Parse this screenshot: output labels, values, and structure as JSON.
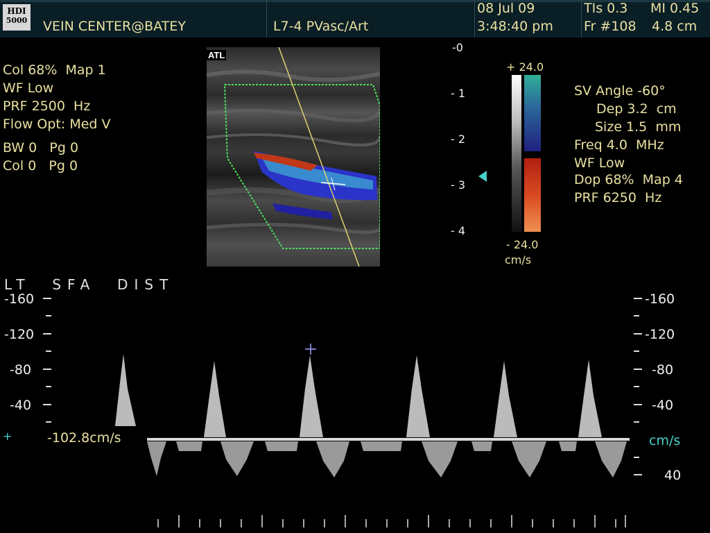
{
  "header": {
    "logo": {
      "line1": "HDI",
      "line2": "5000"
    },
    "institution": "VEIN CENTER@BATEY",
    "transducer": "L7-4 PVasc/Art",
    "date": "08 Jul 09",
    "time": "3:48:40 pm",
    "tis": "TIs 0.3",
    "mi": "MI 0.45",
    "frame": "Fr #108",
    "depth": "4.8 cm"
  },
  "left_params": {
    "color_gain": "Col 68%  Map 1",
    "wall_filter": "WF Low",
    "prf": "PRF 2500  Hz",
    "flow_opt": "Flow Opt: Med V",
    "bw_line": "BW 0   Pg 0",
    "col_line": "Col 0   Pg 0"
  },
  "image": {
    "logo": "ATL"
  },
  "depth_scale": {
    "labels": [
      "-0",
      "- 1",
      "- 2",
      "- 3",
      "- 4"
    ]
  },
  "color_bar": {
    "max": "+ 24.0",
    "min": "- 24.0",
    "unit": "cm/s"
  },
  "doppler_params": {
    "sv_angle": "SV Angle -60°",
    "depth": "Dep 3.2  cm",
    "size": "Size 1.5  mm",
    "freq": "Freq 4.0  MHz",
    "wf": "WF Low",
    "dop": "Dop 68%  Map 4",
    "prf": "PRF 6250  Hz"
  },
  "spectral": {
    "label": "LT  SFA  DIST",
    "left_scale": [
      "-160",
      "-120",
      "-80",
      "-40"
    ],
    "right_scale": [
      "-160",
      "-120",
      "-80",
      "-40"
    ],
    "right_unit": "cm/s",
    "right_bottom": "40",
    "measurement": "-102.8cm/s"
  },
  "colors": {
    "text": "#e8e0a0",
    "accent": "#46d0c8",
    "color_box": "#50e060",
    "baseline": "#d8d8d8"
  }
}
